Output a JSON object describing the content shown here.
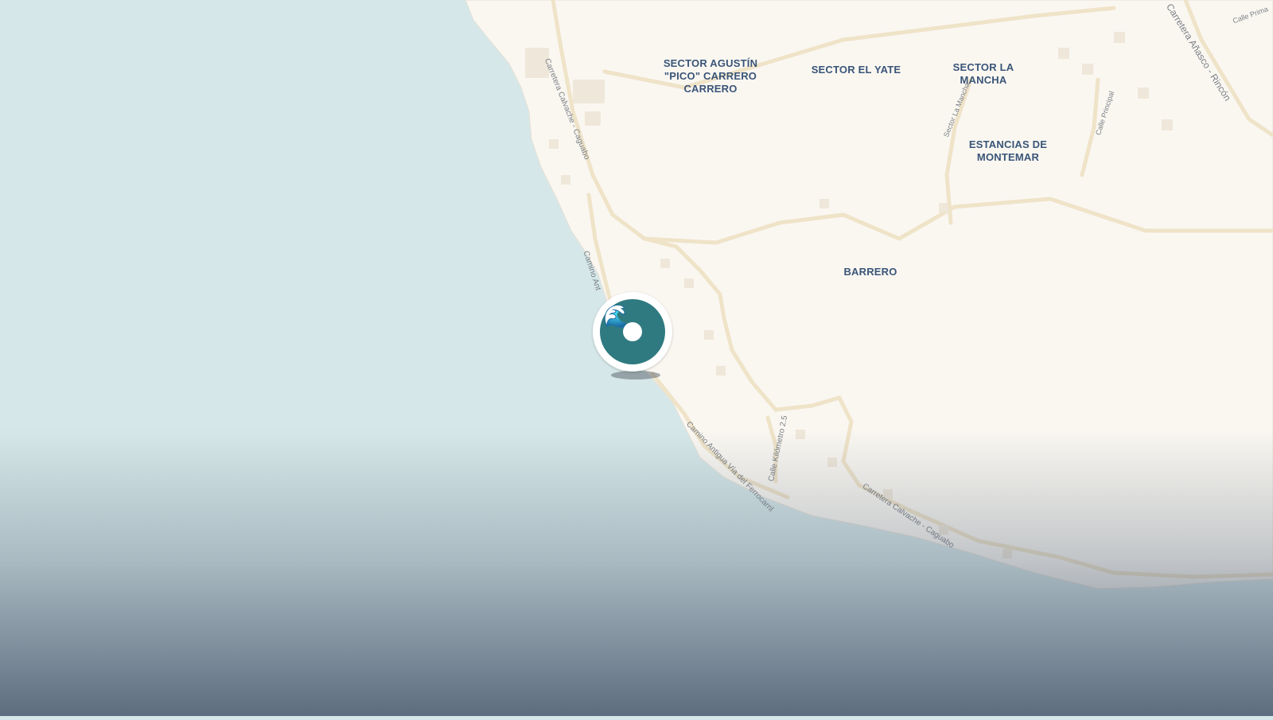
{
  "map": {
    "areas": [
      {
        "id": "sector-agustin",
        "lines": [
          "SECTOR AGUSTÍN",
          "\"PICO\" CARRERO",
          "CARRERO"
        ]
      },
      {
        "id": "sector-el-yate",
        "lines": [
          "SECTOR EL YATE"
        ]
      },
      {
        "id": "sector-la-mancha",
        "lines": [
          "SECTOR LA",
          "MANCHA"
        ]
      },
      {
        "id": "estancias-de-montemar",
        "lines": [
          "ESTANCIAS DE",
          "MONTEMAR"
        ]
      },
      {
        "id": "barrero",
        "lines": [
          "BARRERO"
        ]
      }
    ],
    "roads": [
      {
        "id": "carretera-calvache-caguabo-north",
        "name": "Carretera Calvache - Caguabo"
      },
      {
        "id": "camino-ant",
        "name": "Camino Ant"
      },
      {
        "id": "camino-antigua-via",
        "name": "Camino Antigua Vía del Ferrocarril"
      },
      {
        "id": "calle-kilometro",
        "name": "Calle Kilómetro 2.5"
      },
      {
        "id": "carretera-calvache-caguabo-south",
        "name": "Carretera Calvache - Caguabo"
      },
      {
        "id": "carretera-anasco-rincon",
        "name": "Carretera Añasco - Rincón"
      },
      {
        "id": "sector-la-mancha-road",
        "name": "Sector La Mancha"
      },
      {
        "id": "calle-principal-1",
        "name": "Calle Principal"
      },
      {
        "id": "calle-principal-2",
        "name": "Calle Prima"
      }
    ],
    "marker": {
      "icon": "wave-icon",
      "glyph": "🌊",
      "color": "#2f7a80"
    },
    "colors": {
      "water": "#d5e7e8",
      "land": "#faf7f1",
      "road": "#f3e8d2",
      "label": "#3a5578"
    }
  }
}
